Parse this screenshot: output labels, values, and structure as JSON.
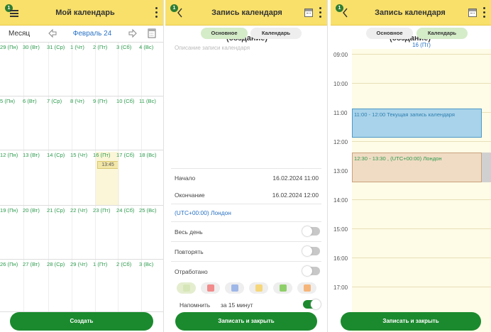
{
  "screen1": {
    "title": "Мой календарь",
    "month_label": "Месяц",
    "month_value": "Февраль 24",
    "rows": [
      [
        "29 (Пн)",
        "30 (Вт)",
        "31 (Ср)",
        "1 (Чт)",
        "2 (Пт)",
        "3 (Сб)",
        "4 (Вс)"
      ],
      [
        "5 (Пн)",
        "6 (Вт)",
        "7 (Ср)",
        "8 (Чт)",
        "9 (Пт)",
        "10 (Сб)",
        "11 (Вс)"
      ],
      [
        "12 (Пн)",
        "13 (Вт)",
        "14 (Ср)",
        "15 (Чт)",
        "16 (Пт)",
        "17 (Сб)",
        "18 (Вс)"
      ],
      [
        "19 (Пн)",
        "20 (Вт)",
        "21 (Ср)",
        "22 (Чт)",
        "23 (Пт)",
        "24 (Сб)",
        "25 (Вс)"
      ],
      [
        "26 (Пн)",
        "27 (Вт)",
        "28 (Ср)",
        "29 (Чт)",
        "1 (Пт)",
        "2 (Сб)",
        "3 (Вс)"
      ]
    ],
    "event_time": "13:45",
    "create_button": "Создать"
  },
  "screen2": {
    "title": "Запись календаря (создание)",
    "tab_main": "Основное",
    "tab_calendar": "Календарь",
    "description_placeholder": "Описание записи календаря",
    "start_label": "Начало",
    "start_value": "16.02.2024  11:00",
    "end_label": "Окончание",
    "end_value": "16.02.2024  12:00",
    "timezone": "(UTC+00:00) Лондон",
    "all_day_label": "Весь день",
    "repeat_label": "Повторять",
    "worked_label": "Отработано",
    "remind_label": "Напомнить",
    "remind_value": "за 15 минут",
    "save_button": "Записать и закрыть",
    "colors": [
      "#d7e6b8",
      "#f28b8b",
      "#9fb7e8",
      "#f6d67a",
      "#8fcf6a",
      "#f5b57a"
    ]
  },
  "screen3": {
    "title": "Запись календаря (создание)",
    "tab_main": "Основное",
    "tab_calendar": "Календарь",
    "day_header": "16 (Пт)",
    "hours": [
      "09:00",
      "10:00",
      "11:00",
      "12:00",
      "13:00",
      "14:00",
      "15:00",
      "16:00",
      "17:00"
    ],
    "event1": "11:00 - 12:00 Текущая запись календаря",
    "event2": "12:30 - 13:30 , (UTC+00:00) Лондон",
    "save_button": "Записать и закрыть"
  },
  "badge": "1"
}
